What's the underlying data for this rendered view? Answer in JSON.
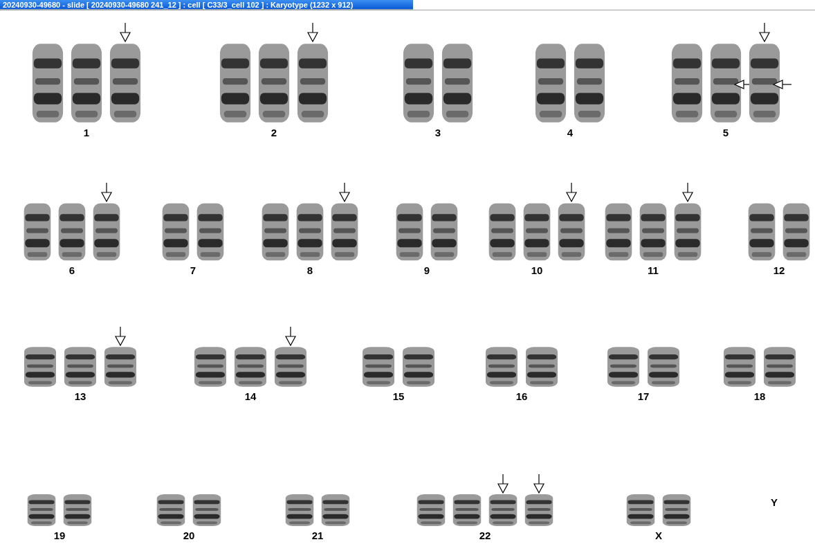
{
  "window": {
    "title": "20240930-49680 - slide [ 20240930-49680 241_12 ] : cell [ C33/3_cell 102 ] : Karyotype  (1232 x 912)"
  },
  "rows": [
    {
      "groups": [
        {
          "label": "1",
          "chromosomes": [
            {
              "kind": "chromosome"
            },
            {
              "kind": "chromosome"
            },
            {
              "kind": "chromosome",
              "arrows": [
                {
                  "kind": "down"
                }
              ]
            }
          ]
        },
        {
          "label": "2",
          "chromosomes": [
            {
              "kind": "chromosome"
            },
            {
              "kind": "chromosome"
            },
            {
              "kind": "chromosome",
              "arrows": [
                {
                  "kind": "down"
                }
              ]
            }
          ]
        },
        {
          "label": "3",
          "chromosomes": [
            {
              "kind": "chromosome"
            },
            {
              "kind": "chromosome"
            }
          ]
        },
        {
          "label": "4",
          "chromosomes": [
            {
              "kind": "chromosome"
            },
            {
              "kind": "chromosome"
            }
          ]
        },
        {
          "label": "5",
          "chromosomes": [
            {
              "kind": "chromosome"
            },
            {
              "kind": "chromosome",
              "arrows": [
                {
                  "kind": "left"
                }
              ]
            },
            {
              "kind": "chromosome",
              "arrows": [
                {
                  "kind": "down"
                },
                {
                  "kind": "left"
                }
              ]
            }
          ]
        }
      ]
    },
    {
      "groups": [
        {
          "label": "6",
          "chromosomes": [
            {
              "kind": "chromosome"
            },
            {
              "kind": "chromosome"
            },
            {
              "kind": "chromosome",
              "arrows": [
                {
                  "kind": "down"
                }
              ]
            }
          ]
        },
        {
          "label": "7",
          "chromosomes": [
            {
              "kind": "chromosome"
            },
            {
              "kind": "chromosome"
            }
          ]
        },
        {
          "label": "8",
          "chromosomes": [
            {
              "kind": "chromosome"
            },
            {
              "kind": "chromosome"
            },
            {
              "kind": "chromosome",
              "arrows": [
                {
                  "kind": "down"
                }
              ]
            }
          ]
        },
        {
          "label": "9",
          "chromosomes": [
            {
              "kind": "chromosome"
            },
            {
              "kind": "chromosome"
            }
          ]
        },
        {
          "label": "10",
          "chromosomes": [
            {
              "kind": "chromosome"
            },
            {
              "kind": "chromosome"
            },
            {
              "kind": "chromosome",
              "arrows": [
                {
                  "kind": "down"
                }
              ]
            }
          ]
        },
        {
          "label": "11",
          "chromosomes": [
            {
              "kind": "chromosome"
            },
            {
              "kind": "chromosome"
            },
            {
              "kind": "chromosome",
              "arrows": [
                {
                  "kind": "down"
                }
              ]
            }
          ]
        },
        {
          "label": "12",
          "chromosomes": [
            {
              "kind": "chromosome"
            },
            {
              "kind": "chromosome"
            }
          ]
        }
      ]
    },
    {
      "groups": [
        {
          "label": "13",
          "chromosomes": [
            {
              "kind": "chromosome"
            },
            {
              "kind": "chromosome"
            },
            {
              "kind": "chromosome",
              "arrows": [
                {
                  "kind": "down"
                }
              ]
            }
          ]
        },
        {
          "label": "14",
          "chromosomes": [
            {
              "kind": "chromosome"
            },
            {
              "kind": "chromosome"
            },
            {
              "kind": "chromosome",
              "arrows": [
                {
                  "kind": "down"
                }
              ]
            }
          ]
        },
        {
          "label": "15",
          "chromosomes": [
            {
              "kind": "chromosome"
            },
            {
              "kind": "chromosome"
            }
          ]
        },
        {
          "label": "16",
          "chromosomes": [
            {
              "kind": "chromosome"
            },
            {
              "kind": "chromosome"
            }
          ]
        },
        {
          "label": "17",
          "chromosomes": [
            {
              "kind": "chromosome"
            },
            {
              "kind": "chromosome"
            }
          ]
        },
        {
          "label": "18",
          "chromosomes": [
            {
              "kind": "chromosome"
            },
            {
              "kind": "chromosome"
            }
          ]
        }
      ]
    },
    {
      "groups": [
        {
          "label": "19",
          "chromosomes": [
            {
              "kind": "chromosome"
            },
            {
              "kind": "chromosome"
            }
          ]
        },
        {
          "label": "20",
          "chromosomes": [
            {
              "kind": "chromosome"
            },
            {
              "kind": "chromosome"
            }
          ]
        },
        {
          "label": "21",
          "chromosomes": [
            {
              "kind": "chromosome"
            },
            {
              "kind": "chromosome"
            }
          ]
        },
        {
          "label": "22",
          "chromosomes": [
            {
              "kind": "chromosome"
            },
            {
              "kind": "chromosome"
            },
            {
              "kind": "chromosome",
              "arrows": [
                {
                  "kind": "down"
                }
              ]
            },
            {
              "kind": "chromosome",
              "arrows": [
                {
                  "kind": "down"
                }
              ]
            }
          ]
        },
        {
          "label": "X",
          "chromosomes": [
            {
              "kind": "chromosome"
            },
            {
              "kind": "chromosome"
            }
          ]
        },
        {
          "label": "Y"
        }
      ]
    }
  ]
}
